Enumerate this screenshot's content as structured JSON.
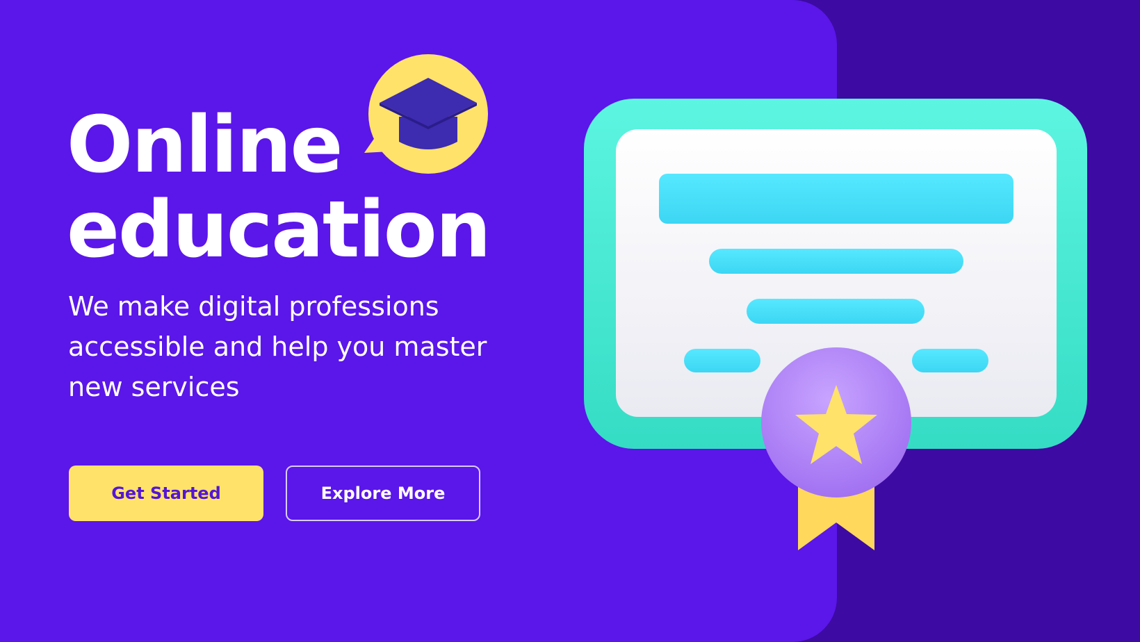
{
  "hero": {
    "title_line1": "Online",
    "title_line2": "education",
    "subtitle": "We make digital professions accessible and help you master new services"
  },
  "actions": {
    "primary_label": "Get Started",
    "secondary_label": "Explore More"
  },
  "icons": {
    "bubble": "graduation-cap-icon",
    "certificate": "certificate-icon",
    "medal": "star-medal-icon"
  },
  "colors": {
    "page_background": "#3d0aa3",
    "panel_background": "#5b16ea",
    "accent_yellow": "#ffe26a",
    "cap_blue": "#3d2bb0",
    "certificate_frame": "#4ef0d8",
    "certificate_lines": "#4ae2fb",
    "medal_purple": "#b78bff"
  }
}
